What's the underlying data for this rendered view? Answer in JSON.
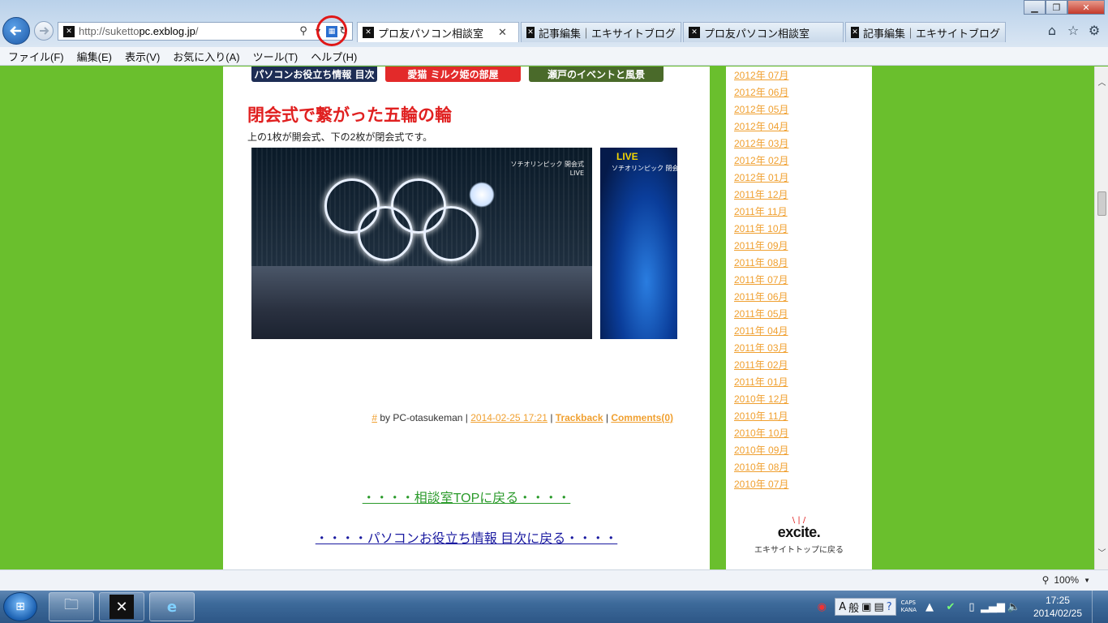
{
  "browser": {
    "address": {
      "prefix": "http://suketto",
      "domain": "pc.exblog.jp",
      "suffix": "/"
    },
    "tabs": [
      {
        "label": "プロ友パソコン相談室",
        "active": true
      },
      {
        "label": "記事編集｜エキサイトブログ",
        "active": false
      },
      {
        "label": "プロ友パソコン相談室",
        "active": false
      },
      {
        "label": "記事編集｜エキサイトブログ",
        "active": false
      }
    ],
    "menu": [
      "ファイル(F)",
      "編集(E)",
      "表示(V)",
      "お気に入り(A)",
      "ツール(T)",
      "ヘルプ(H)"
    ],
    "zoom": "100%"
  },
  "banners": [
    "パソコンお役立ち情報 目次",
    "愛猫 ミルク姫の部屋",
    "瀬戸のイベントと風景"
  ],
  "post": {
    "title": "閉会式で繋がった五輪の輪",
    "subtitle": "上の1枚が開会式、下の2枚が閉会式です。",
    "photo1_caption_line1": "ソチオリンピック 開会式",
    "photo1_caption_line2": "LIVE",
    "photo2_live": "LIVE",
    "photo2_caption": "ソチオリンピック 閉会式",
    "meta": {
      "hash": "#",
      "by": "by PC-otasukeman |",
      "datetime": "2014-02-25 17:21",
      "sep1": "|",
      "trackback": "Trackback",
      "sep2": "|",
      "comments": "Comments(0)"
    }
  },
  "links": {
    "top": "・・・・相談室TOPに戻る・・・・",
    "index": "・・・・パソコンお役立ち情報 目次に戻る・・・・"
  },
  "archives": [
    "2012年 07月",
    "2012年 06月",
    "2012年 05月",
    "2012年 04月",
    "2012年 03月",
    "2012年 02月",
    "2012年 01月",
    "2011年 12月",
    "2011年 11月",
    "2011年 10月",
    "2011年 09月",
    "2011年 08月",
    "2011年 07月",
    "2011年 06月",
    "2011年 05月",
    "2011年 04月",
    "2011年 03月",
    "2011年 02月",
    "2011年 01月",
    "2010年 12月",
    "2010年 11月",
    "2010年 10月",
    "2010年 09月",
    "2010年 08月",
    "2010年 07月"
  ],
  "excite": {
    "logo": "excite.",
    "sub": "エキサイトトップに戻る"
  },
  "taskbar": {
    "ime_mode": "A",
    "ime_kanji": "般",
    "caps": "CAPS",
    "kana": "KANA",
    "time": "17:25",
    "date": "2014/02/25"
  }
}
